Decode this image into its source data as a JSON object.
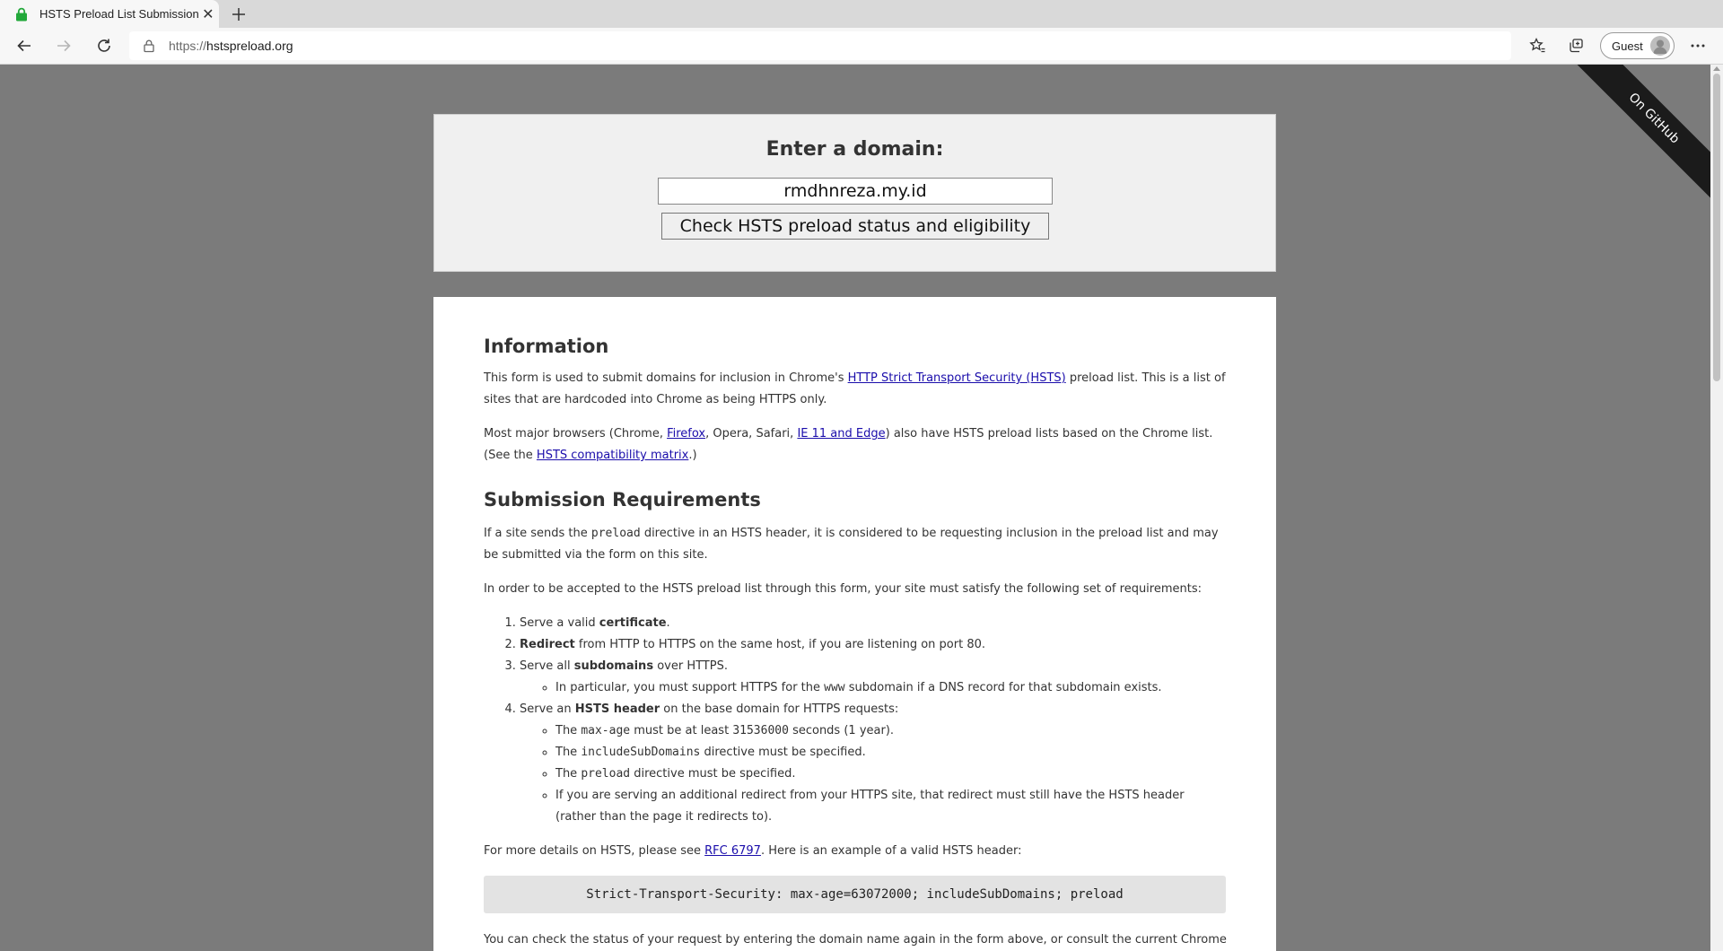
{
  "browser": {
    "tab_title": "HSTS Preload List Submission",
    "url_prefix": "https://",
    "url_host": "hstspreload.org",
    "profile_label": "Guest"
  },
  "ribbon": {
    "label": "On GitHub"
  },
  "form": {
    "heading": "Enter a domain:",
    "domain_value": "rmdhnreza.my.id",
    "check_button": "Check HSTS preload status and eligibility"
  },
  "content": {
    "info_heading": "Information",
    "info_p1": {
      "before": "This form is used to submit domains for inclusion in Chrome's ",
      "link": "HTTP Strict Transport Security (HSTS)",
      "after": " preload list. This is a list of sites that are hardcoded into Chrome as being HTTPS only."
    },
    "info_p2": {
      "t1": "Most major browsers (Chrome, ",
      "link_firefox": "Firefox",
      "t2": ", Opera, Safari, ",
      "link_ie": "IE 11 and Edge",
      "t3": ") also have HSTS preload lists based on the Chrome list. (See the ",
      "link_matrix": "HSTS compatibility matrix",
      "t4": ".)"
    },
    "req_heading": "Submission Requirements",
    "req_p1": {
      "before": "If a site sends the ",
      "code": "preload",
      "after": " directive in an HSTS header, it is considered to be requesting inclusion in the preload list and may be submitted via the form on this site."
    },
    "req_p2": "In order to be accepted to the HSTS preload list through this form, your site must satisfy the following set of requirements:",
    "req1": {
      "t1": "Serve a valid ",
      "b": "certificate",
      "t2": "."
    },
    "req2": {
      "b": "Redirect",
      "t2": " from HTTP to HTTPS on the same host, if you are listening on port 80."
    },
    "req3": {
      "t1": "Serve all ",
      "b": "subdomains",
      "t2": " over HTTPS."
    },
    "req3_sub": {
      "t1": "In particular, you must support HTTPS for the ",
      "code": "www",
      "t2": " subdomain if a DNS record for that subdomain exists."
    },
    "req4": {
      "t1": "Serve an ",
      "b": "HSTS header",
      "t2": " on the base domain for HTTPS requests:"
    },
    "req4_a": {
      "t1": "The ",
      "code1": "max-age",
      "t2": " must be at least ",
      "code2": "31536000",
      "t3": " seconds (1 year)."
    },
    "req4_b": {
      "t1": "The ",
      "code": "includeSubDomains",
      "t2": " directive must be specified."
    },
    "req4_c": {
      "t1": "The ",
      "code": "preload",
      "t2": " directive must be specified."
    },
    "req4_d": "If you are serving an additional redirect from your HTTPS site, that redirect must still have the HSTS header (rather than the page it redirects to).",
    "details_p": {
      "before": "For more details on HSTS, please see ",
      "link": "RFC 6797",
      "after": ". Here is an example of a valid HSTS header:"
    },
    "header_example": "Strict-Transport-Security: max-age=63072000; includeSubDomains; preload",
    "status_p": "You can check the status of your request by entering the domain name again in the form above, or consult the current Chrome"
  }
}
